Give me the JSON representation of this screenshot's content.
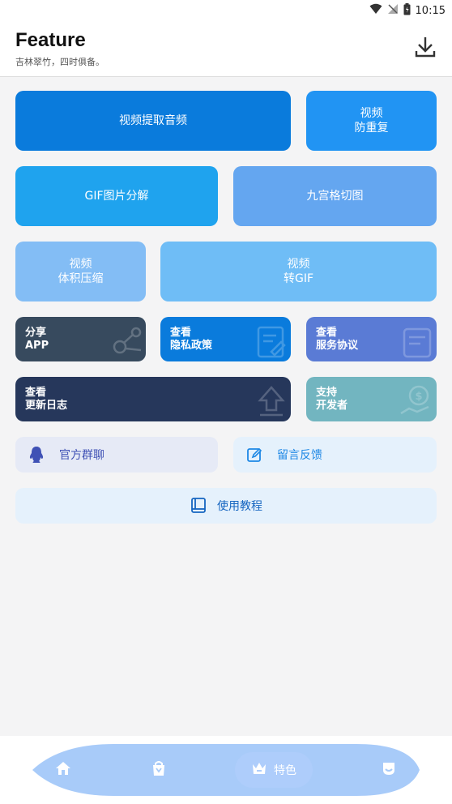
{
  "status": {
    "time": "10:15"
  },
  "header": {
    "title": "Feature",
    "subtitle": "吉林翠竹，四时俱备。"
  },
  "tiles": {
    "extract_audio": "视频提取音频",
    "dedup_line1": "视频",
    "dedup_line2": "防重复",
    "gif_split": "GIF图片分解",
    "nine_grid": "九宫格切图",
    "compress_line1": "视频",
    "compress_line2": "体积压缩",
    "to_gif_line1": "视频",
    "to_gif_line2": "转GIF"
  },
  "cards": {
    "share_line1": "分享",
    "share_line2": "APP",
    "privacy_line1": "查看",
    "privacy_line2": "隐私政策",
    "service_line1": "查看",
    "service_line2": "服务协议",
    "changelog_line1": "查看",
    "changelog_line2": "更新日志",
    "support_line1": "支持",
    "support_line2": "开发者"
  },
  "pills": {
    "group_chat": "官方群聊",
    "feedback": "留言反馈",
    "tutorial": "使用教程"
  },
  "nav": {
    "active_label": "特色"
  },
  "icons": [
    "wifi-icon",
    "no-signal-icon",
    "battery-icon",
    "download-icon",
    "share-icon",
    "edit-note-icon",
    "document-icon",
    "upload-icon",
    "money-icon",
    "qq-icon",
    "edit-icon",
    "book-icon",
    "home-icon",
    "bag-icon",
    "crown-icon",
    "profile-icon"
  ],
  "colors": {
    "extract_audio": "#0a7bdc",
    "dedup": "#2194f3",
    "gif_split": "#1fa3ee",
    "nine_grid": "#64a6f0",
    "compress": "#83bdf5",
    "to_gif": "#6fbdf6",
    "share": "#374a5e",
    "privacy": "#0a7bdc",
    "service": "#5a7bd5",
    "changelog": "#26375b",
    "support": "#72b5c0",
    "pill_group": "#e6eaf6",
    "pill_feedback": "#e5f1fc",
    "nav_bar": "#a8cbf9"
  }
}
